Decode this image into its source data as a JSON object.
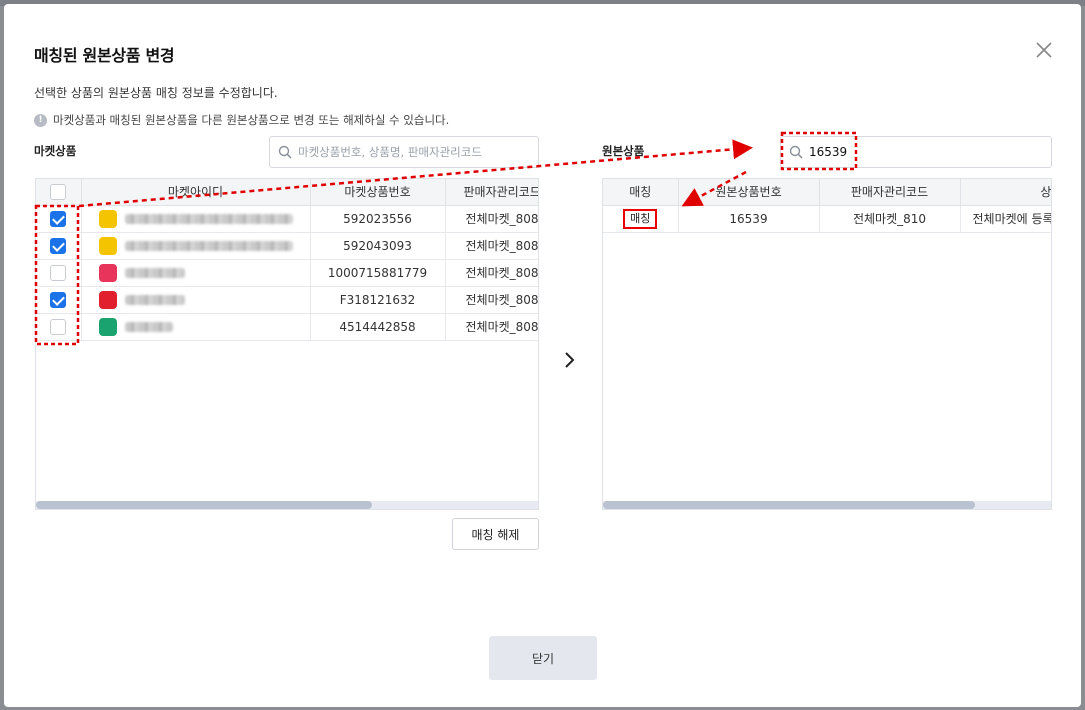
{
  "modal": {
    "title": "매칭된 원본상품 변경",
    "description": "선택한 상품의 원본상품 매칭 정보를 수정합니다.",
    "info_text": "마켓상품과 매칭된 원본상품을 다른 원본상품으로 변경 또는 해제하실 수 있습니다.",
    "info_icon_glyph": "!"
  },
  "left": {
    "section_label": "마켓상품",
    "search_placeholder": "마켓상품번호, 상품명, 판매자관리코드",
    "columns": [
      "",
      "마켓아이디",
      "마켓상품번호",
      "판매자관리코드"
    ],
    "rows": [
      {
        "checked": true,
        "market_icon": "coupang-eats-icon",
        "icon_color": "#f5c400",
        "product_no": "592023556",
        "seller_code": "전체마켓_808"
      },
      {
        "checked": true,
        "market_icon": "coupang-eats-icon",
        "icon_color": "#f5c400",
        "product_no": "592043093",
        "seller_code": "전체마켓_808"
      },
      {
        "checked": false,
        "market_icon": "ssg-icon",
        "icon_color": "#e8345a",
        "product_no": "1000715881779",
        "seller_code": "전체마켓_808"
      },
      {
        "checked": true,
        "market_icon": "auction-icon",
        "icon_color": "#e2202d",
        "product_no": "F318121632",
        "seller_code": "전체마켓_808"
      },
      {
        "checked": false,
        "market_icon": "gmarket-icon",
        "icon_color": "#1aa36f",
        "product_no": "4514442858",
        "seller_code": "전체마켓_808"
      }
    ],
    "unmatch_button": "매칭 해제"
  },
  "right": {
    "section_label": "원본상품",
    "search_value": "16539",
    "columns": [
      "매칭",
      "원본상품번호",
      "판매자관리코드",
      "상품"
    ],
    "rows": [
      {
        "match_label": "매칭",
        "origin_no": "16539",
        "seller_code": "전체마켓_810",
        "product": "전체마켓에 등록"
      }
    ]
  },
  "footer": {
    "close_button": "닫기"
  },
  "colors": {
    "accent": "#1a73e8",
    "annotation": "#e00000",
    "button_gray": "#e4e8ee"
  }
}
